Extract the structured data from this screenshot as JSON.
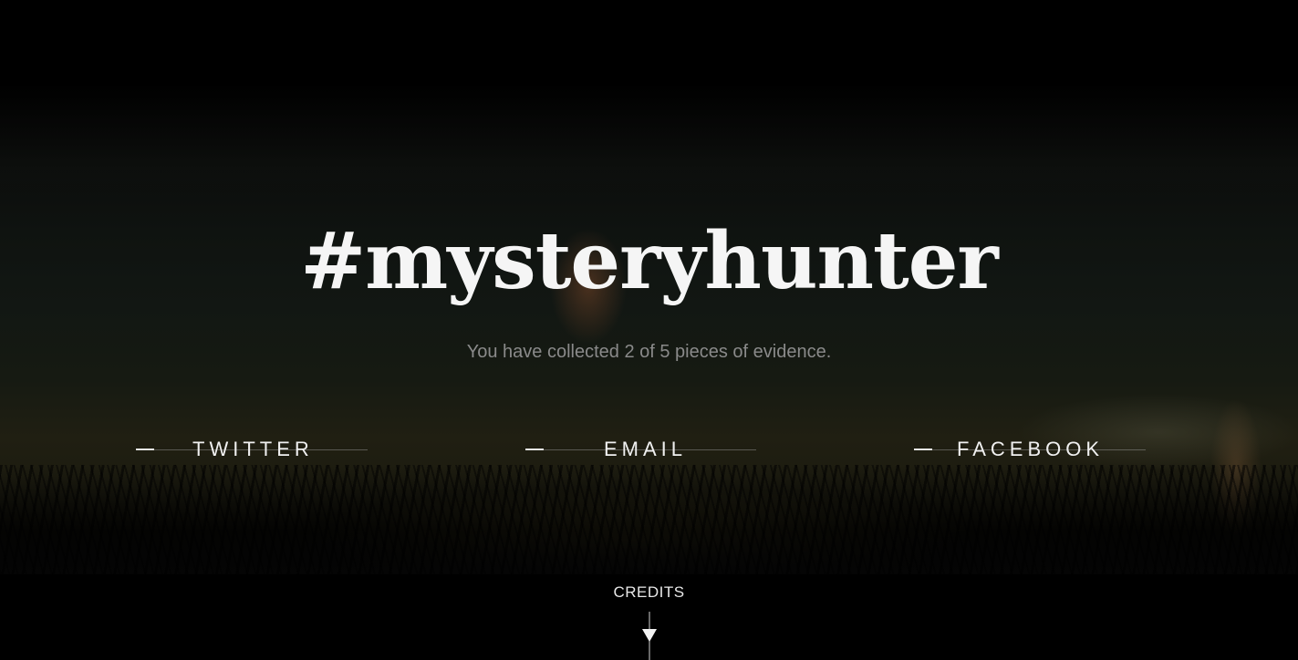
{
  "headline": "#mysteryhunter",
  "progress_text": "You have collected 2 of 5 pieces of evidence.",
  "evidence": {
    "collected": 2,
    "total": 5
  },
  "share": {
    "twitter_label": "TWITTER",
    "email_label": "EMAIL",
    "facebook_label": "FACEBOOK"
  },
  "credits_label": "CREDITS",
  "icons": {
    "credits_arrow": "arrow-down-icon"
  },
  "colors": {
    "background": "#000000",
    "headline": "#f5f5f5",
    "subtext": "#8a8a8a",
    "link_text": "#f0f0f0"
  }
}
